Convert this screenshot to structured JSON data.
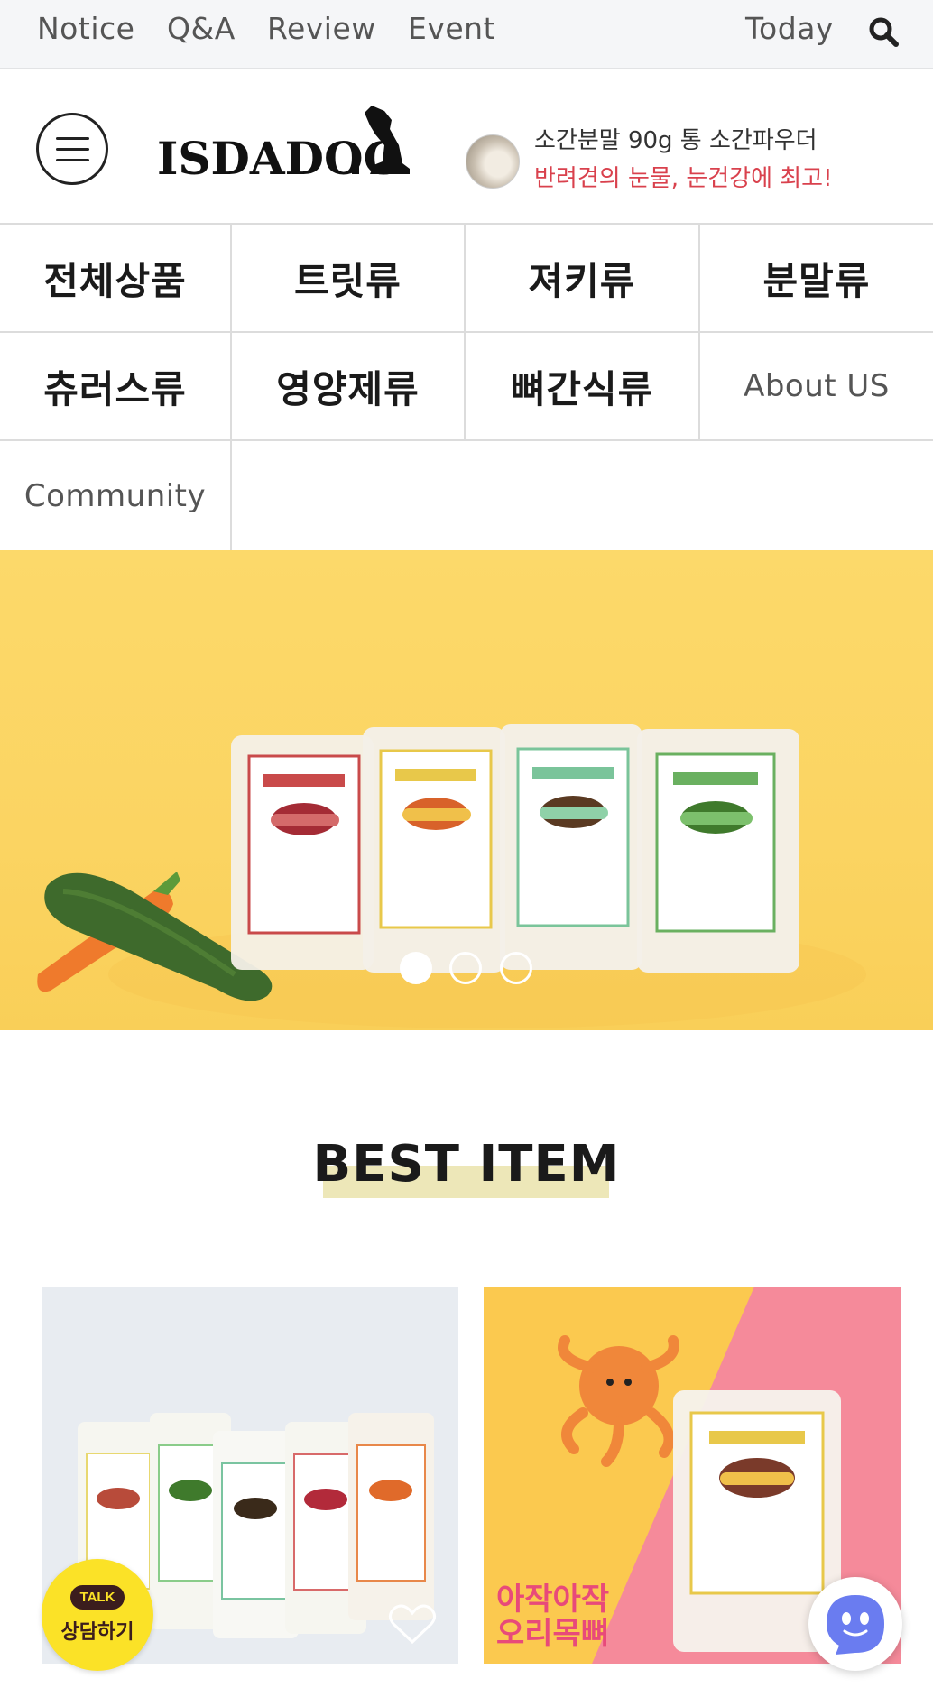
{
  "topbar": {
    "links": [
      "Notice",
      "Q&A",
      "Review",
      "Event"
    ],
    "today": "Today"
  },
  "header": {
    "logo_text": "ISDADOG",
    "promo_line1": "소간분말 90g 통 소간파우더",
    "promo_line2": "반려견의 눈물, 눈건강에 최고!"
  },
  "nav": {
    "items": [
      "전체상품",
      "트릿류",
      "져키류",
      "분말류",
      "츄러스류",
      "영양제류",
      "뼈간식류",
      "About US",
      "Community"
    ]
  },
  "banner": {
    "slides_total": 3,
    "active_slide": 1
  },
  "best": {
    "title": "BEST ITEM"
  },
  "products": [
    {
      "image": "isdadog-treat-set"
    },
    {
      "image": "duck-neck-bone",
      "overlay_line1": "아작아작",
      "overlay_line2": "오리목뼈"
    }
  ],
  "floating": {
    "talk_bubble": "TALK",
    "talk_label": "상담하기"
  },
  "colors": {
    "accent_red": "#d9414d",
    "banner_yellow": "#fbd462",
    "highlight": "#ede7b8"
  }
}
